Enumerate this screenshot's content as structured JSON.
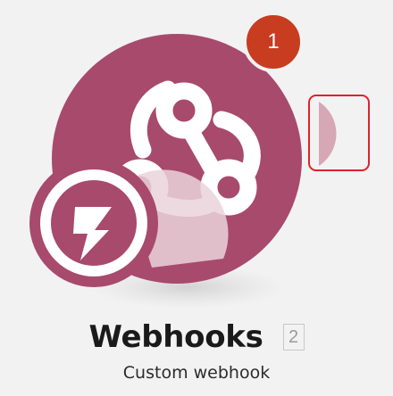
{
  "module": {
    "name": "Webhooks",
    "version": "2",
    "subtitle": "Custom webhook",
    "icon": "webhook-icon",
    "trigger_icon": "instant-trigger-lightning-icon",
    "handle_icon": "half-circle-connector-icon",
    "brand_color": "#a84a6c",
    "handle_color": "#d6a7b5"
  },
  "badge": {
    "count": "1",
    "color": "#c83c20"
  },
  "selection_color": "#e0212e"
}
